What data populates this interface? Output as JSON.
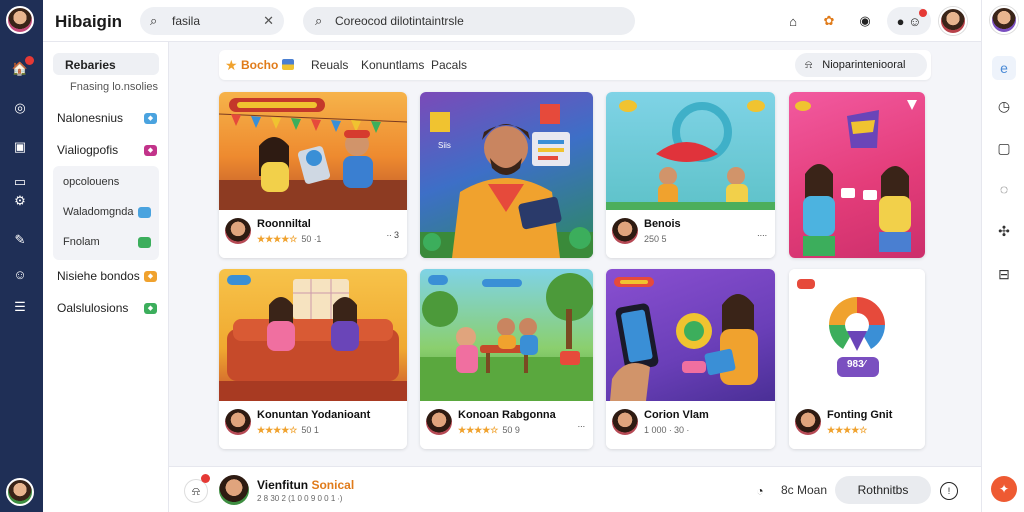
{
  "app": {
    "title": "Hibaigin"
  },
  "search": {
    "query": "fasila",
    "placeholder": "Coreocod dilotintaintrsle"
  },
  "sidebar": {
    "header": "Rebaries",
    "subheader": "Fnasing lo.nsolies",
    "items": [
      {
        "label": "Nalonesnius",
        "badge_color": "#4aa3df"
      },
      {
        "label": "Vialiogpofis",
        "badge_color": "#c2338a"
      },
      {
        "label": "Nisiehe bondos",
        "badge_color": "#f0a22e"
      },
      {
        "label": "Oalslulosions",
        "badge_color": "#3cae5c"
      }
    ],
    "group": [
      {
        "label": "opcolouens",
        "badge_color": ""
      },
      {
        "label": "Waladomgnda",
        "badge_color": "#4aa3df"
      },
      {
        "label": "Fnolam",
        "badge_color": "#3cae5c"
      }
    ]
  },
  "tabs": {
    "brand": "Bocho",
    "items": [
      "Reuals",
      "Konuntlams",
      "Pacals"
    ],
    "action": "Nioparinteniooral"
  },
  "cards": [
    {
      "title": "Roonniltal",
      "rating": "★★★★☆",
      "count": "50 ∙1",
      "meta": "∙∙ 3"
    },
    {
      "title": "",
      "rating": "",
      "count": "",
      "meta": ""
    },
    {
      "title": "Benois",
      "rating": "",
      "count": "250 5",
      "meta": "∙∙∙∙"
    },
    {
      "title": "",
      "rating": "",
      "count": "",
      "meta": ""
    },
    {
      "title": "Konuntan Yodanioant",
      "rating": "★★★★☆",
      "count": "50 1",
      "meta": ""
    },
    {
      "title": "Konoan Rabgonna",
      "rating": "★★★★☆",
      "count": "50 9",
      "meta": "∙∙∙"
    },
    {
      "title": "Corion Vlam",
      "rating": "",
      "count": "1 000  ∙ 30 ∙",
      "meta": ""
    },
    {
      "title": "Fonting Gnit",
      "rating": "★★★★☆",
      "count": "",
      "meta": ""
    }
  ],
  "badge_text": "983⁄",
  "player": {
    "title_a": "Vienfitun",
    "title_b": "Sonical",
    "subtitle": "2 8 30 2 (1 0 0 9 0 0 1 ∙)",
    "label": "8c Moan",
    "button": "Rothnitbs"
  },
  "colors": {
    "accent": "#e07b1a",
    "rail": "#1f2f56",
    "notify": "#e53935"
  }
}
